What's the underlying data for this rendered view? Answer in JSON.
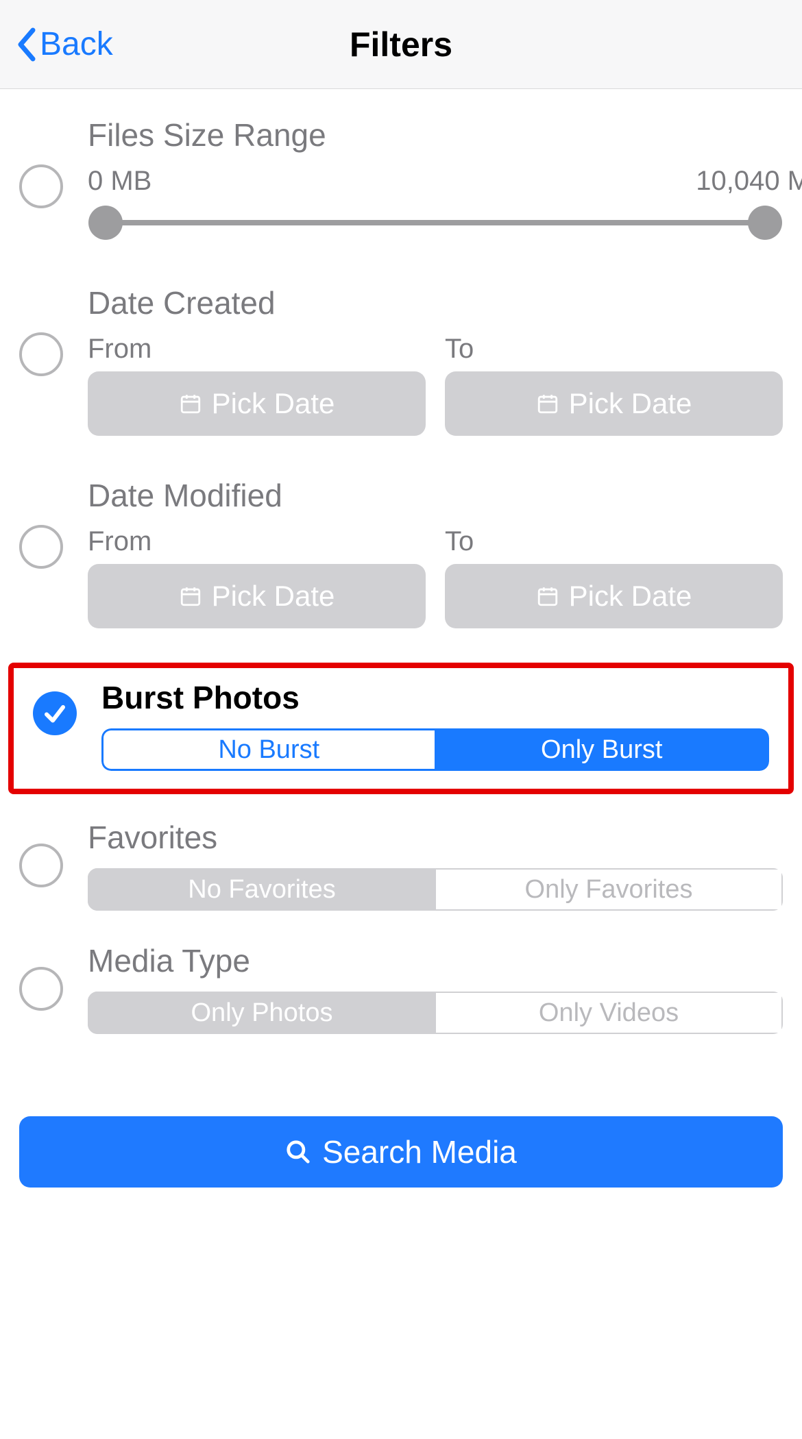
{
  "nav": {
    "back_label": "Back",
    "title": "Filters"
  },
  "filters": {
    "size": {
      "title": "Files Size Range",
      "min_label": "0 MB",
      "max_label": "10,040 M"
    },
    "date_created": {
      "title": "Date Created",
      "from_label": "From",
      "to_label": "To",
      "pick_label": "Pick Date"
    },
    "date_modified": {
      "title": "Date Modified",
      "from_label": "From",
      "to_label": "To",
      "pick_label": "Pick Date"
    },
    "burst": {
      "title": "Burst Photos",
      "option_a": "No Burst",
      "option_b": "Only Burst",
      "selected": "Only Burst",
      "enabled": true
    },
    "favorites": {
      "title": "Favorites",
      "option_a": "No Favorites",
      "option_b": "Only Favorites"
    },
    "media_type": {
      "title": "Media Type",
      "option_a": "Only Photos",
      "option_b": "Only Videos"
    }
  },
  "search_label": "Search Media"
}
